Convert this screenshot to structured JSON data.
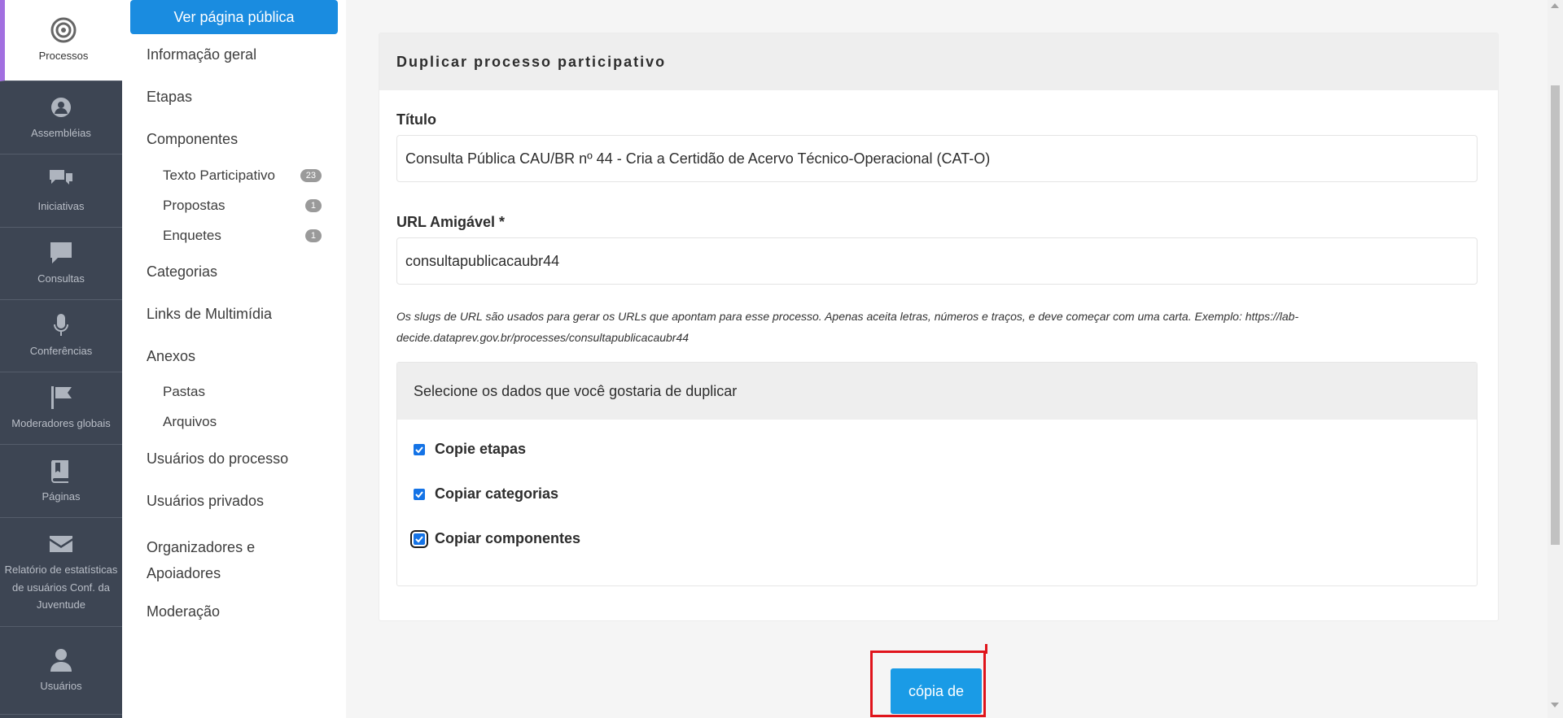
{
  "icon_nav": {
    "items": [
      {
        "label": "Processos",
        "icon": "target-icon",
        "active": true
      },
      {
        "label": "Assembléias",
        "icon": "assembly-icon",
        "active": false
      },
      {
        "label": "Iniciativas",
        "icon": "chat-bubbles-icon",
        "active": false
      },
      {
        "label": "Consultas",
        "icon": "speech-bubble-icon",
        "active": false
      },
      {
        "label": "Conferências",
        "icon": "microphone-icon",
        "active": false
      },
      {
        "label": "Moderadores globais",
        "icon": "flag-icon",
        "active": false
      },
      {
        "label": "Páginas",
        "icon": "book-icon",
        "active": false
      },
      {
        "label": "Relatório de estatísticas de usuários Conf. da Juventude",
        "icon": "envelope-icon",
        "active": false
      },
      {
        "label": "Usuários",
        "icon": "user-icon",
        "active": false
      }
    ]
  },
  "sub_nav": {
    "public_button": "Ver página pública",
    "informacao_geral": "Informação geral",
    "etapas": "Etapas",
    "componentes": "Componentes",
    "components": [
      {
        "label": "Texto Participativo",
        "count": "23"
      },
      {
        "label": "Propostas",
        "count": "1"
      },
      {
        "label": "Enquetes",
        "count": "1"
      }
    ],
    "categorias": "Categorias",
    "links_multimidia": "Links de Multimídia",
    "anexos": "Anexos",
    "pastas": "Pastas",
    "arquivos": "Arquivos",
    "usuarios_processo": "Usuários do processo",
    "usuarios_privados": "Usuários privados",
    "organizadores": "Organizadores e Apoiadores",
    "moderacao": "Moderação"
  },
  "form": {
    "card_title": "Duplicar processo participativo",
    "title_label": "Título",
    "title_value": "Consulta Pública CAU/BR nº 44 - Cria a Certidão de Acervo Técnico-Operacional (CAT-O)",
    "slug_label": "URL Amigável *",
    "slug_value": "consultapublicacaubr44",
    "help_text": "Os slugs de URL são usados para gerar os URLs que apontam para esse processo. Apenas aceita letras, números e traços, e deve começar com uma carta. Exemplo: https://lab-decide.dataprev.gov.br/processes/consultapublicacaubr44",
    "duplicate_heading": "Selecione os dados que você gostaria de duplicar",
    "checkboxes": [
      {
        "label": "Copie etapas",
        "checked": true
      },
      {
        "label": "Copiar categorias",
        "checked": true
      },
      {
        "label": "Copiar componentes",
        "checked": true
      }
    ],
    "submit_label": "cópia de"
  },
  "colors": {
    "nav_bg": "#3d4553",
    "primary": "#1a8ce0",
    "active_accent": "#a26fe0",
    "highlight": "#e0141b"
  }
}
